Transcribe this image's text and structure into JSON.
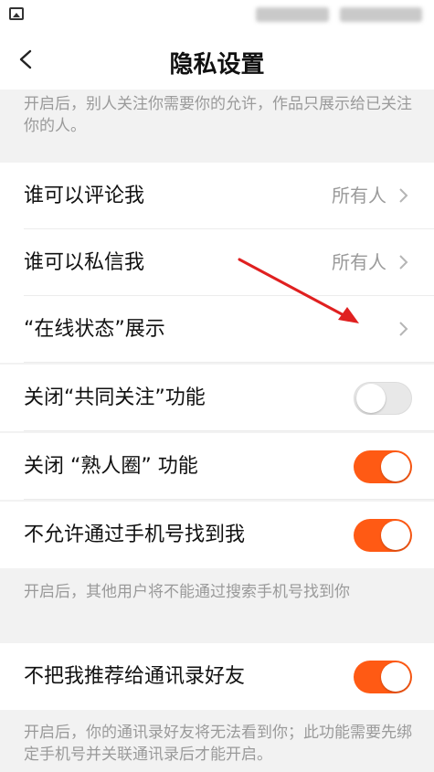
{
  "nav": {
    "title": "隐私设置"
  },
  "descriptions": {
    "private_account": "开启后，别人关注你需要你的允许，作品只展示给已关注你的人。",
    "phone_search": "开启后，其他用户将不能通过搜索手机号找到你",
    "contacts": "开启后，你的通讯录好友将无法看到你；此功能需要先绑定手机号并关联通讯录后才能开启。"
  },
  "rows": {
    "comment": {
      "label": "谁可以评论我",
      "value": "所有人"
    },
    "message": {
      "label": "谁可以私信我",
      "value": "所有人"
    },
    "online_status": {
      "label": "“在线状态”展示"
    },
    "mutual_follow": {
      "label": "关闭“共同关注”功能",
      "enabled": false
    },
    "acquaintance": {
      "label": "关闭 “熟人圈” 功能",
      "enabled": true
    },
    "phone_search": {
      "label": "不允许通过手机号找到我",
      "enabled": true
    },
    "contacts": {
      "label": "不把我推荐给通讯录好友",
      "enabled": true
    }
  },
  "colors": {
    "accent": "#ff5a14",
    "annotation_arrow": "#e02020"
  },
  "icons": [
    "gallery-icon",
    "back-arrow-icon",
    "chevron-right-icon"
  ]
}
